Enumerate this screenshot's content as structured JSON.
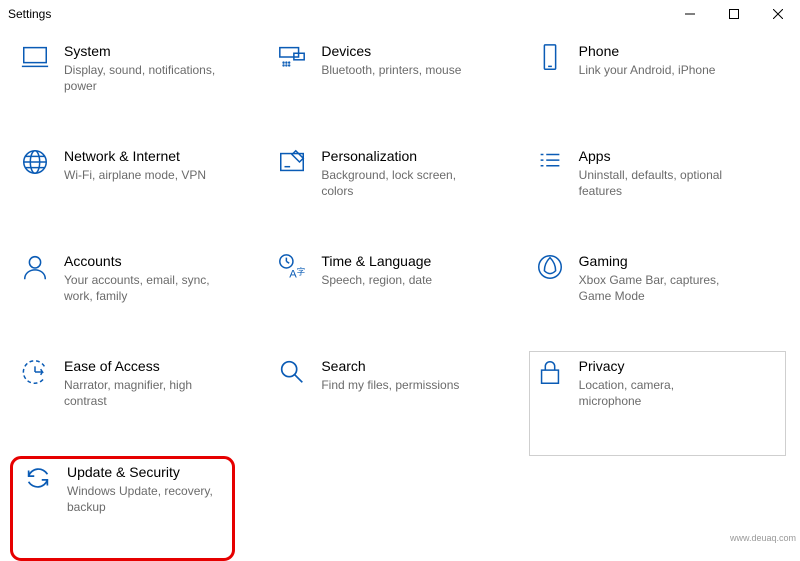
{
  "window": {
    "title": "Settings"
  },
  "tiles": [
    {
      "name": "System",
      "desc": "Display, sound, notifications, power"
    },
    {
      "name": "Devices",
      "desc": "Bluetooth, printers, mouse"
    },
    {
      "name": "Phone",
      "desc": "Link your Android, iPhone"
    },
    {
      "name": "Network & Internet",
      "desc": "Wi-Fi, airplane mode, VPN"
    },
    {
      "name": "Personalization",
      "desc": "Background, lock screen, colors"
    },
    {
      "name": "Apps",
      "desc": "Uninstall, defaults, optional features"
    },
    {
      "name": "Accounts",
      "desc": "Your accounts, email, sync, work, family"
    },
    {
      "name": "Time & Language",
      "desc": "Speech, region, date"
    },
    {
      "name": "Gaming",
      "desc": "Xbox Game Bar, captures, Game Mode"
    },
    {
      "name": "Ease of Access",
      "desc": "Narrator, magnifier, high contrast"
    },
    {
      "name": "Search",
      "desc": "Find my files, permissions"
    },
    {
      "name": "Privacy",
      "desc": "Location, camera, microphone"
    },
    {
      "name": "Update & Security",
      "desc": "Windows Update, recovery, backup"
    }
  ],
  "source": "www.deuaq.com"
}
